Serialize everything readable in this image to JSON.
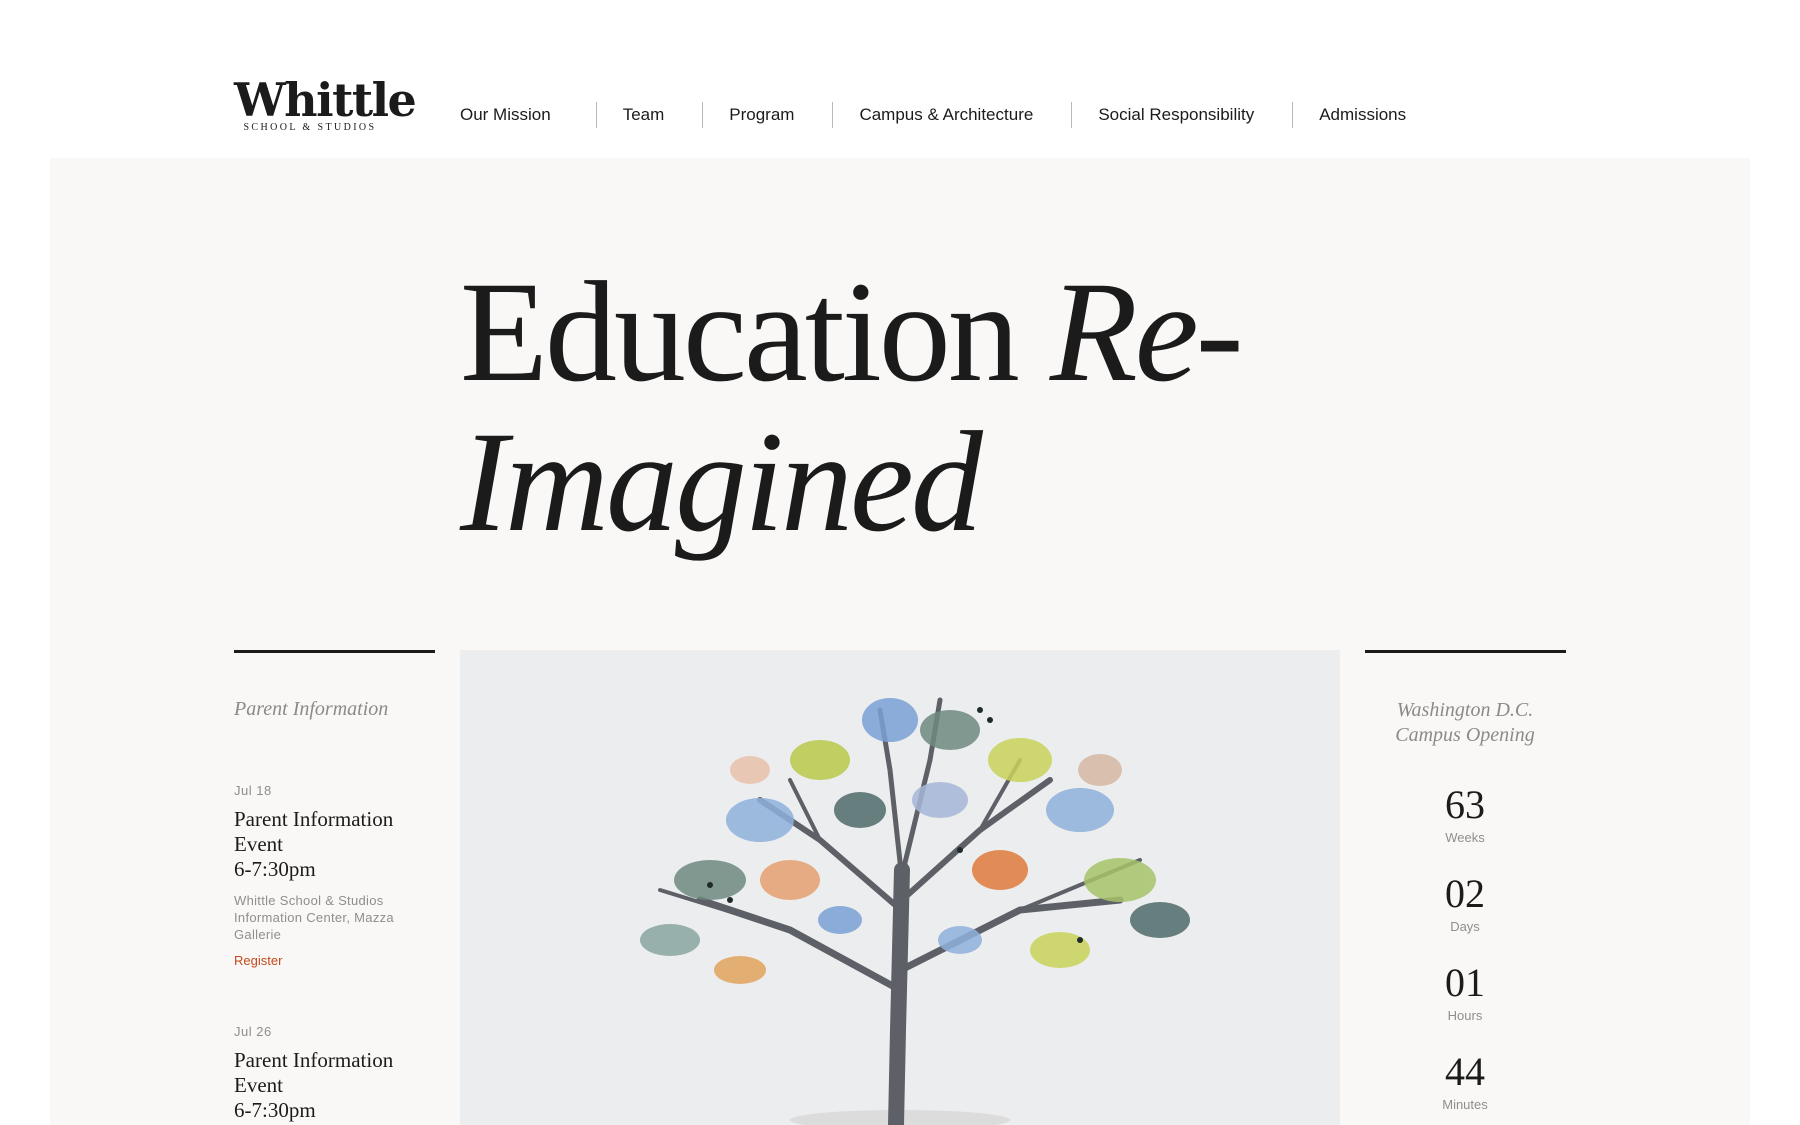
{
  "logo": {
    "word": "Whittle",
    "sub": "SCHOOL & STUDIOS"
  },
  "nav": [
    "Our Mission",
    "Team",
    "Program",
    "Campus & Architecture",
    "Social Responsibility",
    "Admissions"
  ],
  "hero": {
    "line1_roman": "Education ",
    "line1_italic": "Re-",
    "line2_italic": "Imagined"
  },
  "parent_info": {
    "title": "Parent Information",
    "events": [
      {
        "date": "Jul 18",
        "title": "Parent Information Event",
        "time": "6-7:30pm",
        "location": "Whittle School & Studios Information Center, Mazza Gallerie",
        "register": "Register"
      },
      {
        "date": "Jul 26",
        "title": "Parent Information Event",
        "time": "6-7:30pm"
      }
    ]
  },
  "countdown": {
    "title": "Washington D.C. Campus Opening",
    "items": [
      {
        "value": "63",
        "label": "Weeks"
      },
      {
        "value": "02",
        "label": "Days"
      },
      {
        "value": "01",
        "label": "Hours"
      },
      {
        "value": "44",
        "label": "Minutes"
      }
    ]
  },
  "colors": {
    "accent": "#c4491c",
    "hero_bg": "#f9f8f6",
    "text": "#1b1b1b",
    "muted": "#8e8e8e"
  },
  "image": {
    "icon": "tree-illustration"
  }
}
